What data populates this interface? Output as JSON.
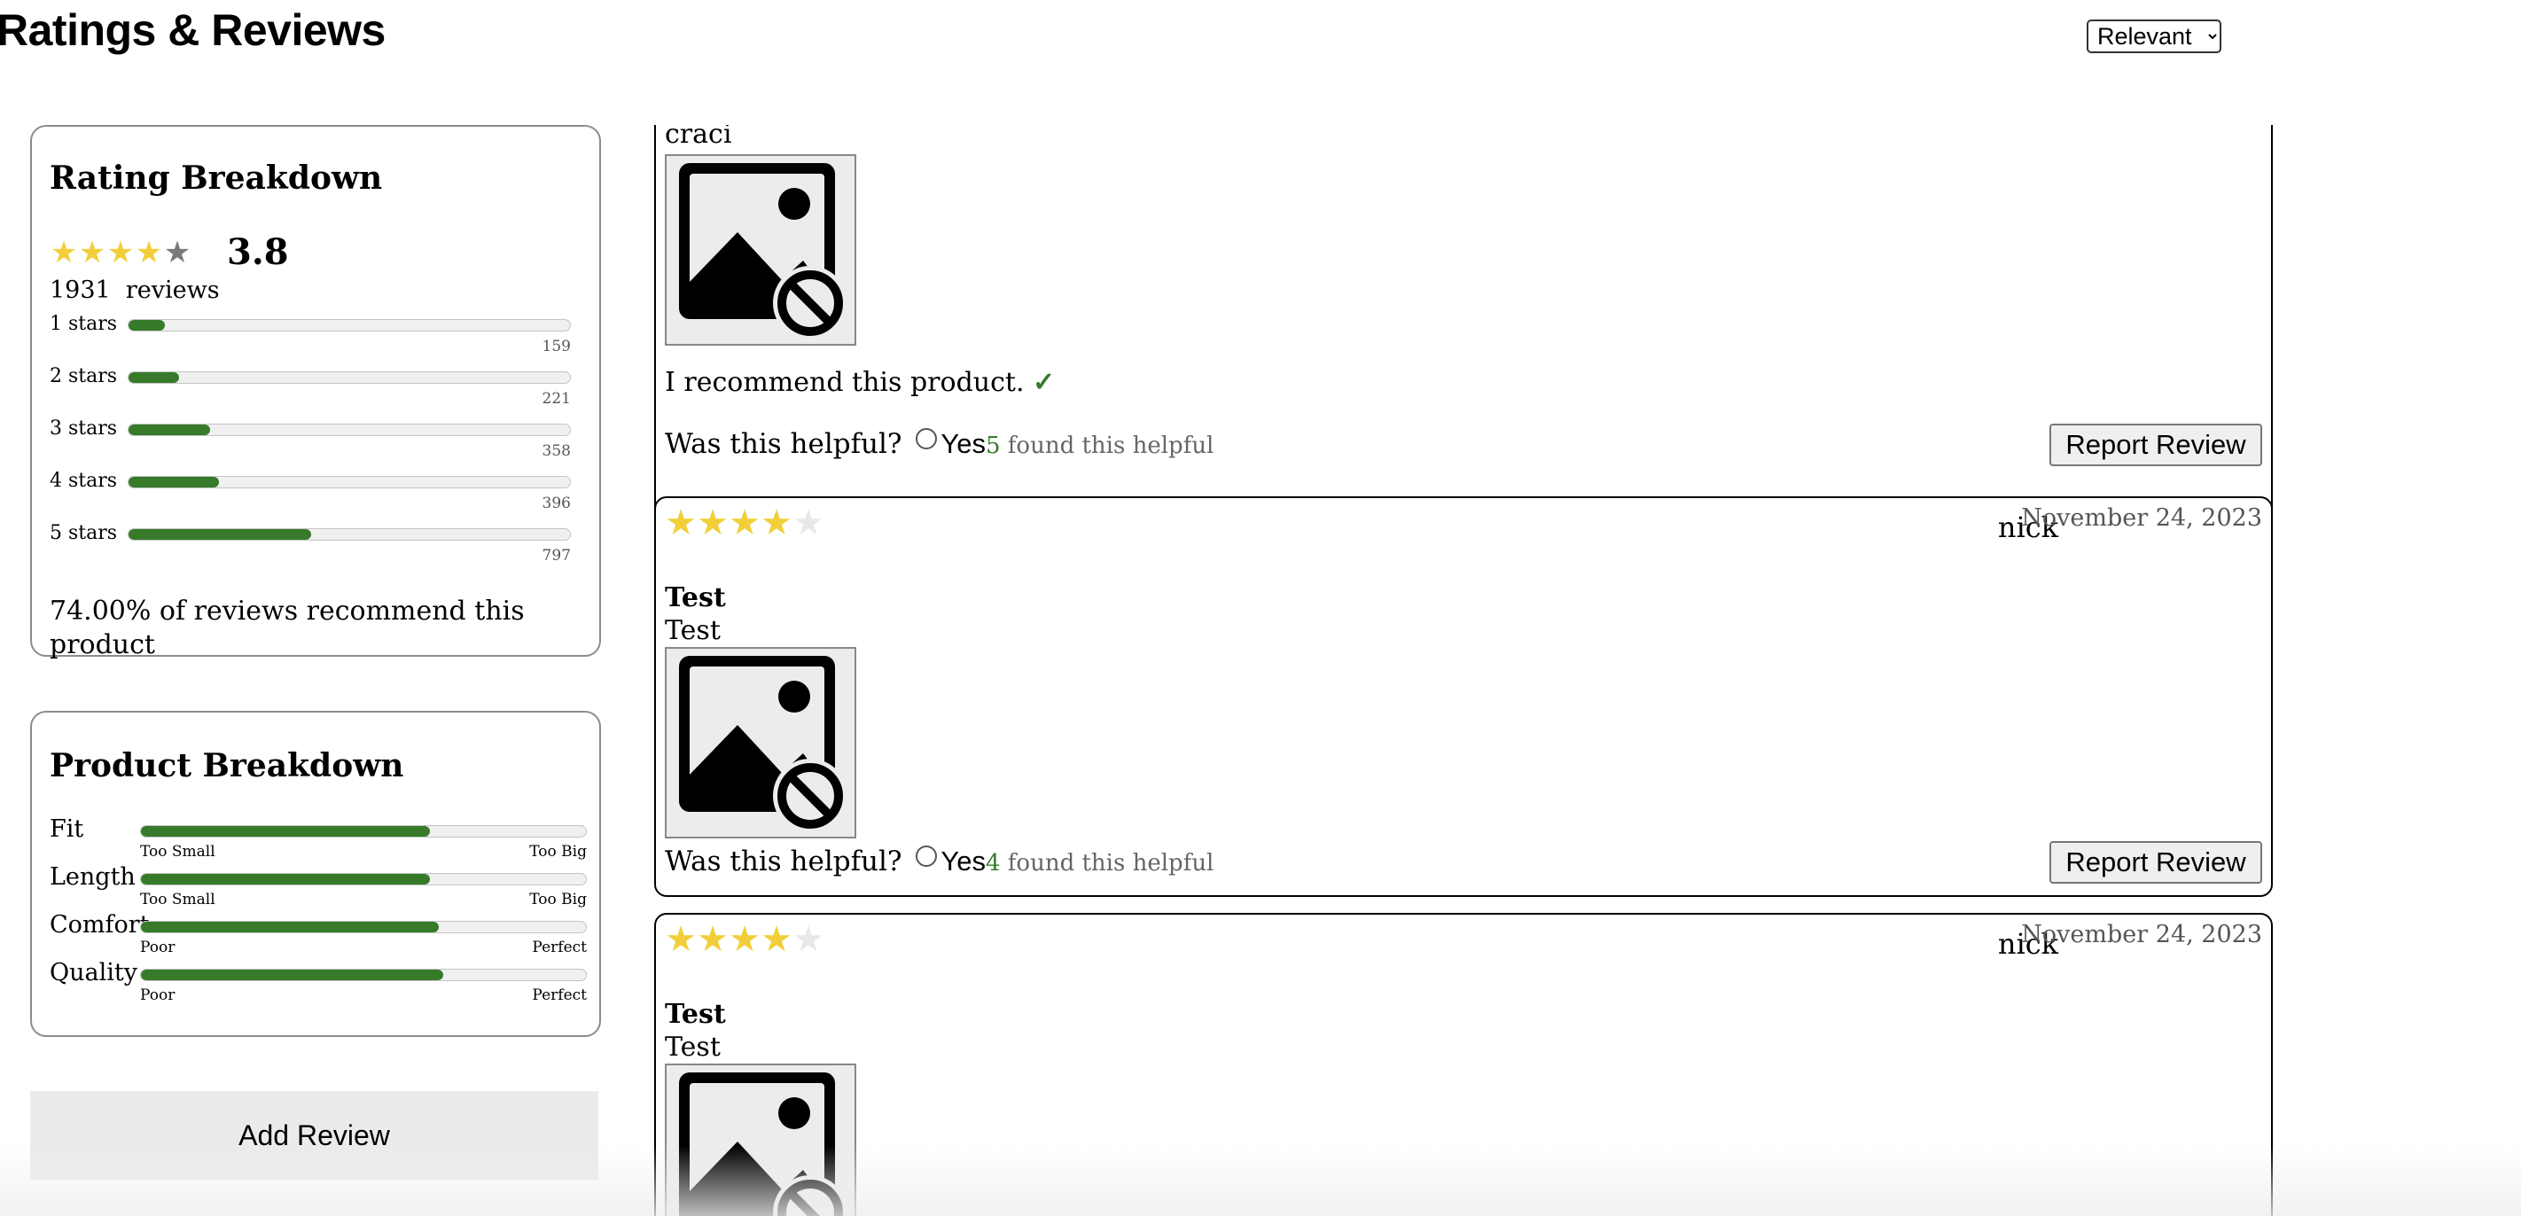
{
  "header": {
    "title": "Ratings & Reviews",
    "sort": {
      "selected": "Relevant"
    }
  },
  "rating_breakdown": {
    "title": "Rating Breakdown",
    "average": "3.8",
    "average_value": 3.8,
    "review_count": "1931",
    "reviews_label": "reviews",
    "distribution": [
      {
        "label": "1 stars",
        "count": "159"
      },
      {
        "label": "2 stars",
        "count": "221"
      },
      {
        "label": "3 stars",
        "count": "358"
      },
      {
        "label": "4 stars",
        "count": "396"
      },
      {
        "label": "5 stars",
        "count": "797"
      }
    ],
    "recommend_text": "74.00% of reviews recommend this product"
  },
  "product_breakdown": {
    "title": "Product Breakdown",
    "factors": [
      {
        "name": "Fit",
        "low": "Too Small",
        "high": "Too Big",
        "value": 0.65
      },
      {
        "name": "Length",
        "low": "Too Small",
        "high": "Too Big",
        "value": 0.65
      },
      {
        "name": "Comfort",
        "low": "Poor",
        "high": "Perfect",
        "value": 0.67
      },
      {
        "name": "Quality",
        "low": "Poor",
        "high": "Perfect",
        "value": 0.68
      }
    ]
  },
  "add_review_label": "Add Review",
  "reviews": [
    {
      "partial_reviewer": "craci",
      "photo_icon": "broken-image-icon",
      "recommend_text": "I recommend this product.",
      "check_mark": "✓",
      "helpful_question": "Was this helpful?",
      "helpful_yes": "Yes",
      "helpful_count": "5",
      "helpful_suffix": " found this helpful",
      "report_label": "Report Review"
    },
    {
      "rating": 4,
      "reviewer": "nick",
      "date": "November 24, 2023",
      "summary": "Test",
      "body": "Test",
      "photo_icon": "broken-image-icon",
      "helpful_question": "Was this helpful?",
      "helpful_yes": "Yes",
      "helpful_count": "4",
      "helpful_suffix": " found this helpful",
      "report_label": "Report Review"
    },
    {
      "rating": 4,
      "reviewer": "nick",
      "date": "November 24, 2023",
      "summary": "Test",
      "body": "Test",
      "photo_icon": "broken-image-icon"
    }
  ],
  "colors": {
    "star": "#f2cf3a",
    "bar_fill": "#367a2a",
    "bar_track": "#f0f0f0",
    "helpful_count": "#367a2a"
  }
}
